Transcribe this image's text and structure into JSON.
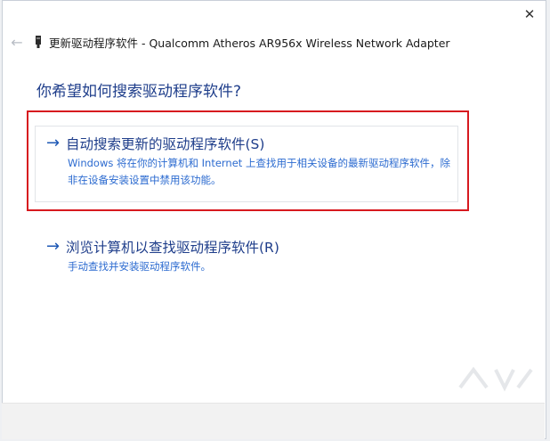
{
  "window": {
    "title": "更新驱动程序软件 - Qualcomm Atheros AR956x Wireless Network Adapter",
    "close_glyph": "✕",
    "back_glyph": "←"
  },
  "question": "你希望如何搜索驱动程序软件?",
  "options": [
    {
      "title": "自动搜索更新的驱动程序软件(S)",
      "description": "Windows 将在你的计算机和 Internet 上查找用于相关设备的最新驱动程序软件，除非在设备安装设置中禁用该功能。",
      "arrow_glyph": "→",
      "highlighted": true
    },
    {
      "title": "浏览计算机以查找驱动程序软件(R)",
      "description": "手动查找并安装驱动程序软件。",
      "arrow_glyph": "→"
    }
  ],
  "colors": {
    "heading_blue": "#1f3e8b",
    "link_blue": "#2c6bd0",
    "highlight_red": "#d7191f"
  },
  "icons": {
    "back": "back-arrow-icon",
    "device": "network-adapter-icon",
    "close": "close-icon",
    "option_arrow": "arrow-right-icon"
  }
}
